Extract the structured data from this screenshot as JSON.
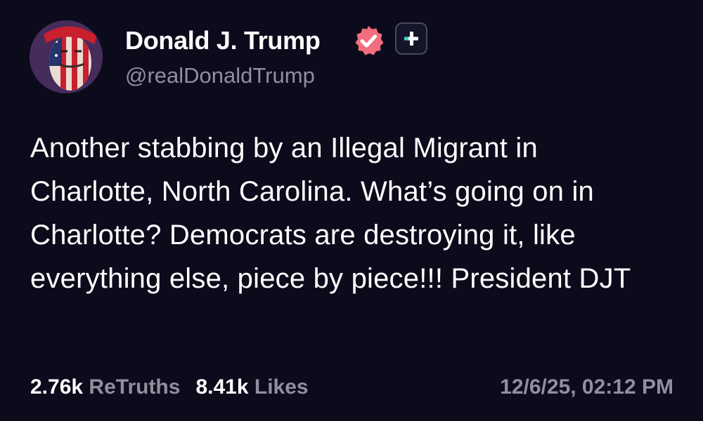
{
  "author": {
    "display_name": "Donald J. Trump",
    "handle": "@realDonaldTrump",
    "verified_icon": "verified-check-icon",
    "plus_icon": "plus-icon"
  },
  "post": {
    "text": "Another stabbing by an Illegal Migrant in Charlotte, North Carolina. What’s going on in Charlotte? Democrats are destroying it, like everything else, piece by piece!!! President DJT"
  },
  "stats": {
    "retruths_count": "2.76k",
    "retruths_label": "ReTruths",
    "likes_count": "8.41k",
    "likes_label": "Likes"
  },
  "timestamp": "12/6/25, 02:12 PM",
  "colors": {
    "background": "#0b0b1c",
    "text": "#ffffff",
    "muted": "#8f8f9d",
    "verified": "#f26d7d",
    "plus_accent": "#3bd6c6"
  }
}
